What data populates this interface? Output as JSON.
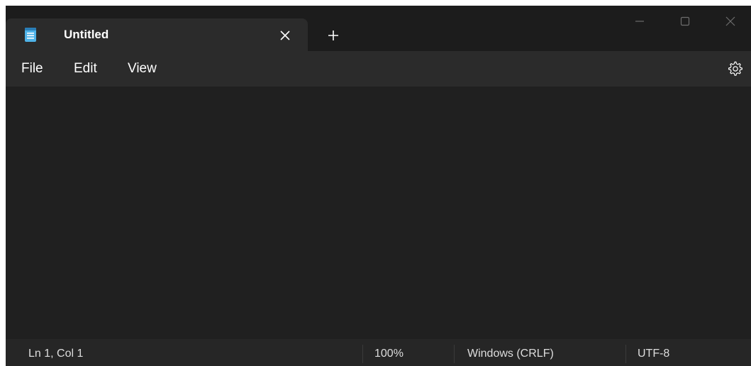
{
  "tab": {
    "title": "Untitled",
    "icon": "notepad-icon",
    "close_icon": "close-icon"
  },
  "new_tab": {
    "icon": "plus-icon"
  },
  "window_controls": {
    "minimize_icon": "minimize-icon",
    "maximize_icon": "maximize-icon",
    "close_icon": "close-icon"
  },
  "menu": {
    "items": [
      {
        "label": "File"
      },
      {
        "label": "Edit"
      },
      {
        "label": "View"
      }
    ],
    "settings_icon": "gear-icon"
  },
  "editor": {
    "content": ""
  },
  "status": {
    "position": "Ln 1, Col 1",
    "zoom": "100%",
    "line_ending": "Windows (CRLF)",
    "encoding": "UTF-8"
  },
  "colors": {
    "titlebar": "#1c1c1c",
    "tab": "#2b2b2b",
    "menubar": "#2b2b2b",
    "editor": "#202020",
    "statusbar": "#262626",
    "notepad_icon": "#4fb3e8",
    "text": "#ffffff"
  }
}
